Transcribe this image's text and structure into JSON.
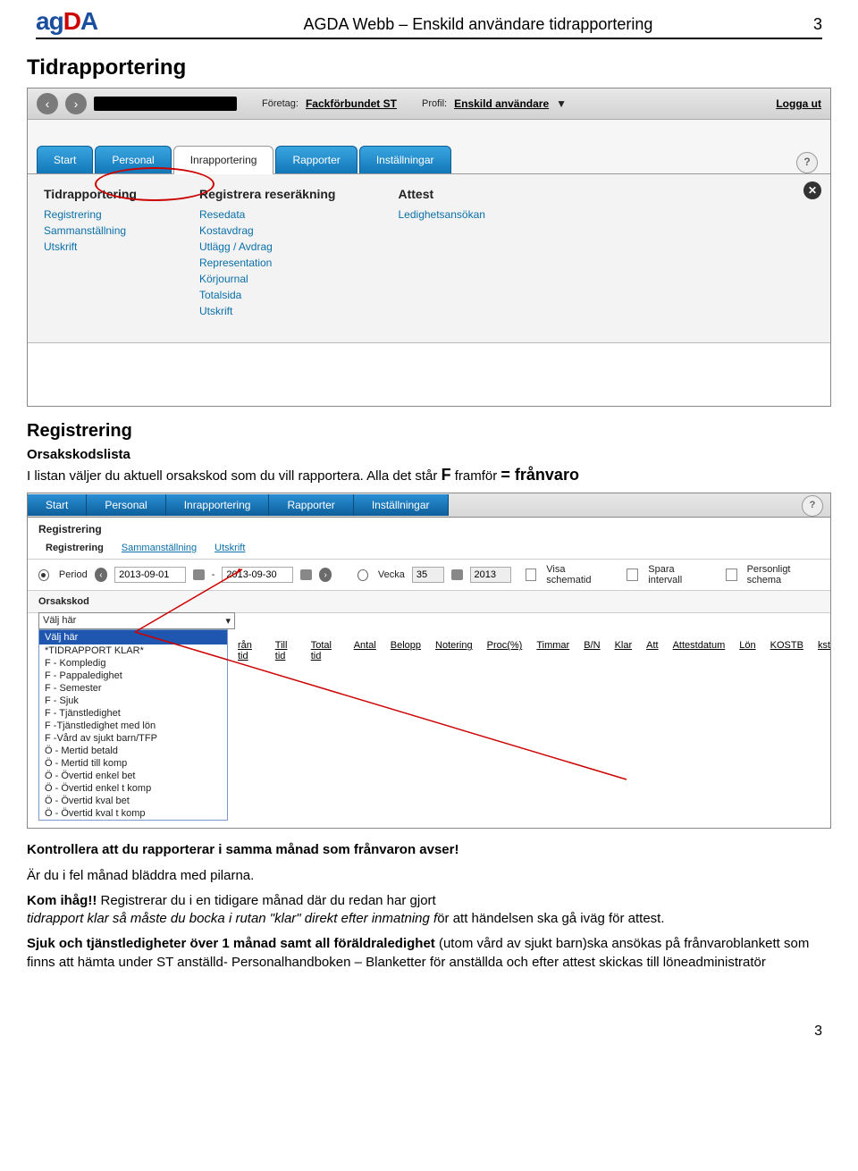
{
  "header": {
    "title": "AGDA Webb – Enskild användare tidrapportering",
    "page": "3",
    "logo_ag": "ag",
    "logo_d": "D",
    "logo_a": "A"
  },
  "doc": {
    "h1": "Tidrapportering",
    "h2": "Registrering",
    "h3": "Orsakskodslista",
    "p1a": "I listan väljer du aktuell orsakskod som du vill rapportera. Alla det står ",
    "p1b": "F",
    "p1c": " framför ",
    "p1d": "= frånvaro",
    "p2": "Kontrollera att du rapporterar i samma månad som frånvaron avser!",
    "p3": "Är du i fel månad bläddra med pilarna.",
    "p4a": "Kom ihåg!!",
    "p4b": " Registrerar du i en tidigare månad där du redan har gjort",
    "p5a": "tidrapport klar så måste du bocka i rutan \"klar\" direkt efter inmatning f",
    "p5b": "ör att händelsen ska gå iväg för attest.",
    "p6a": "Sjuk och tjänstledigheter över 1 månad samt all föräldraledighet ",
    "p6b": "(utom vård av sjukt barn)ska ansökas på frånvaroblankett som finns att hämta under ST anställd- Personalhandboken – Blanketter för anställda och efter attest skickas till löneadministratör"
  },
  "ss1": {
    "foretag_lbl": "Företag:",
    "foretag": "Fackförbundet ST",
    "profil_lbl": "Profil:",
    "profil": "Enskild användare",
    "arrow": "▼",
    "logout": "Logga ut",
    "tabs": [
      "Start",
      "Personal",
      "Inrapportering",
      "Rapporter",
      "Inställningar"
    ],
    "help": "?",
    "close": "✕",
    "col1_h": "Tidrapportering",
    "col1": [
      "Registrering",
      "Sammanställning",
      "Utskrift"
    ],
    "col2_h": "Registrera reseräkning",
    "col2": [
      "Resedata",
      "Kostavdrag",
      "Utlägg / Avdrag",
      "Representation",
      "Körjournal",
      "Totalsida",
      "Utskrift"
    ],
    "col3_h": "Attest",
    "col3": [
      "Ledighetsansökan"
    ]
  },
  "ss2": {
    "tabs": [
      "Start",
      "Personal",
      "Inrapportering",
      "Rapporter",
      "Inställningar"
    ],
    "help": "?",
    "bc": "Registrering",
    "subtabs": [
      "Registrering",
      "Sammanställning",
      "Utskrift"
    ],
    "period_lbl": "Period",
    "d1": "2013-09-01",
    "dash": "-",
    "d2": "2013-09-30",
    "vecka_lbl": "Vecka",
    "vecka": "35",
    "year": "2013",
    "opt1": "Visa schematid",
    "opt2": "Spara intervall",
    "opt3": "Personligt schema",
    "orsak_lbl": "Orsakskod",
    "valj": "Välj här",
    "ddsel": "Välj här",
    "dd": [
      "*TIDRAPPORT KLAR*",
      "F - Kompledig",
      "F - Pappaledighet",
      "F - Semester",
      "F - Sjuk",
      "F - Tjänstledighet",
      "F -Tjänstledighet med lön",
      "F -Vård av sjukt barn/TFP",
      "Ö - Mertid betald",
      "Ö - Mertid till komp",
      "Ö - Övertid enkel bet",
      "Ö - Övertid enkel t komp",
      "Ö - Övertid kval bet",
      "Ö - Övertid kval t komp"
    ],
    "cols": [
      "rån tid",
      "Till tid",
      "Total tid",
      "Antal",
      "Belopp",
      "Notering",
      "Proc(%)",
      "Timmar",
      "B/N",
      "Klar",
      "Att",
      "Attestdatum",
      "Lön",
      "KOSTB",
      "kst"
    ]
  },
  "footer": "3"
}
